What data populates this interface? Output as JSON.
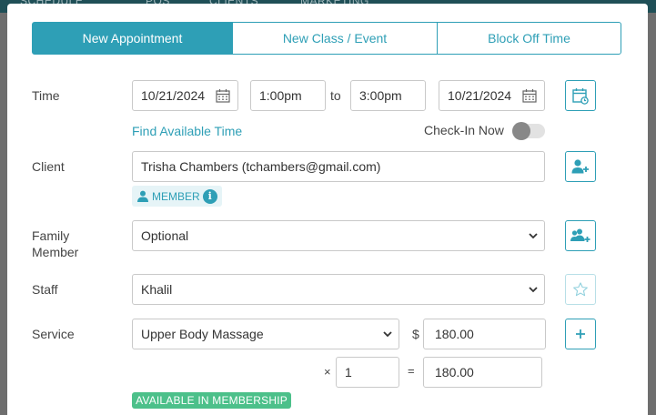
{
  "background": {
    "tabs": [
      "SCHEDULE",
      "POS",
      "CLIENTS",
      "MARKETING"
    ]
  },
  "tabs": [
    {
      "label": "New Appointment",
      "active": true
    },
    {
      "label": "New Class / Event",
      "active": false
    },
    {
      "label": "Block Off Time",
      "active": false
    }
  ],
  "time": {
    "label": "Time",
    "start_date": "10/21/2024",
    "start_time": "1:00pm",
    "to_label": "to",
    "end_time": "3:00pm",
    "end_date": "10/21/2024",
    "find_available": "Find Available Time",
    "check_in_label": "Check-In Now",
    "check_in_on": false
  },
  "client": {
    "label": "Client",
    "value": "Trisha Chambers (tchambers@gmail.com)",
    "badge": "MEMBER",
    "badge_info_icon": "i"
  },
  "family": {
    "label": "Family Member",
    "value": "Optional"
  },
  "staff": {
    "label": "Staff",
    "value": "Khalil"
  },
  "service": {
    "label": "Service",
    "value": "Upper Body Massage",
    "currency": "$",
    "price": "180.00",
    "times": "×",
    "quantity": "1",
    "equals": "=",
    "total": "180.00",
    "membership_badge": "AVAILABLE IN MEMBERSHIP"
  },
  "colors": {
    "accent": "#2e9fb6",
    "success": "#4cc08a"
  },
  "icons": {
    "calendar": "calendar-icon",
    "calendar_refresh": "calendar-refresh-icon",
    "add_client": "add-person-icon",
    "add_family": "add-group-icon",
    "favorite": "star-icon",
    "add_service": "plus-icon",
    "member": "person-icon",
    "info": "info-icon",
    "dropdown": "chevron-down-icon"
  }
}
